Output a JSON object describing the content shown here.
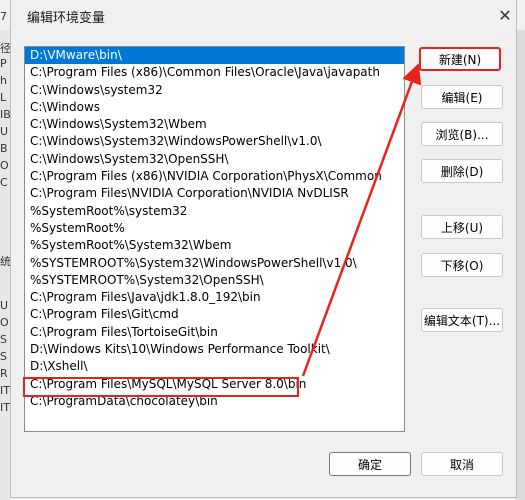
{
  "dialog": {
    "title": "编辑环境变量",
    "close_icon": "close-icon"
  },
  "path_list": {
    "items": [
      "D:\\VMware\\bin\\",
      "C:\\Program Files (x86)\\Common Files\\Oracle\\Java\\javapath",
      "C:\\Windows\\system32",
      "C:\\Windows",
      "C:\\Windows\\System32\\Wbem",
      "C:\\Windows\\System32\\WindowsPowerShell\\v1.0\\",
      "C:\\Windows\\System32\\OpenSSH\\",
      "C:\\Program Files (x86)\\NVIDIA Corporation\\PhysX\\Common",
      "C:\\Program Files\\NVIDIA Corporation\\NVIDIA NvDLISR",
      "%SystemRoot%\\system32",
      "%SystemRoot%",
      "%SystemRoot%\\System32\\Wbem",
      "%SYSTEMROOT%\\System32\\WindowsPowerShell\\v1.0\\",
      "%SYSTEMROOT%\\System32\\OpenSSH\\",
      "C:\\Program Files\\Java\\jdk1.8.0_192\\bin",
      "C:\\Program Files\\Git\\cmd",
      "C:\\Program Files\\TortoiseGit\\bin",
      "D:\\Windows Kits\\10\\Windows Performance Toolkit\\",
      "D:\\Xshell\\",
      "C:\\Program Files\\MySQL\\MySQL Server 8.0\\bin",
      "C:\\ProgramData\\chocolatey\\bin"
    ],
    "selected_index": 0,
    "highlighted_index": 19
  },
  "buttons": {
    "new": "新建(N)",
    "edit": "编辑(E)",
    "browse": "浏览(B)...",
    "delete": "删除(D)",
    "move_up": "上移(U)",
    "move_down": "下移(O)",
    "edit_text": "编辑文本(T)...",
    "ok": "确定",
    "cancel": "取消"
  },
  "annotation": {
    "color": "#e8231c"
  },
  "background_window": {
    "chars": [
      "7",
      "径",
      "P",
      "h",
      "L",
      "IB",
      "U",
      "B",
      "O",
      "C",
      "",
      "",
      "",
      "",
      "统",
      "U",
      "O",
      "S",
      "S",
      "R",
      "IT",
      "IT"
    ]
  }
}
